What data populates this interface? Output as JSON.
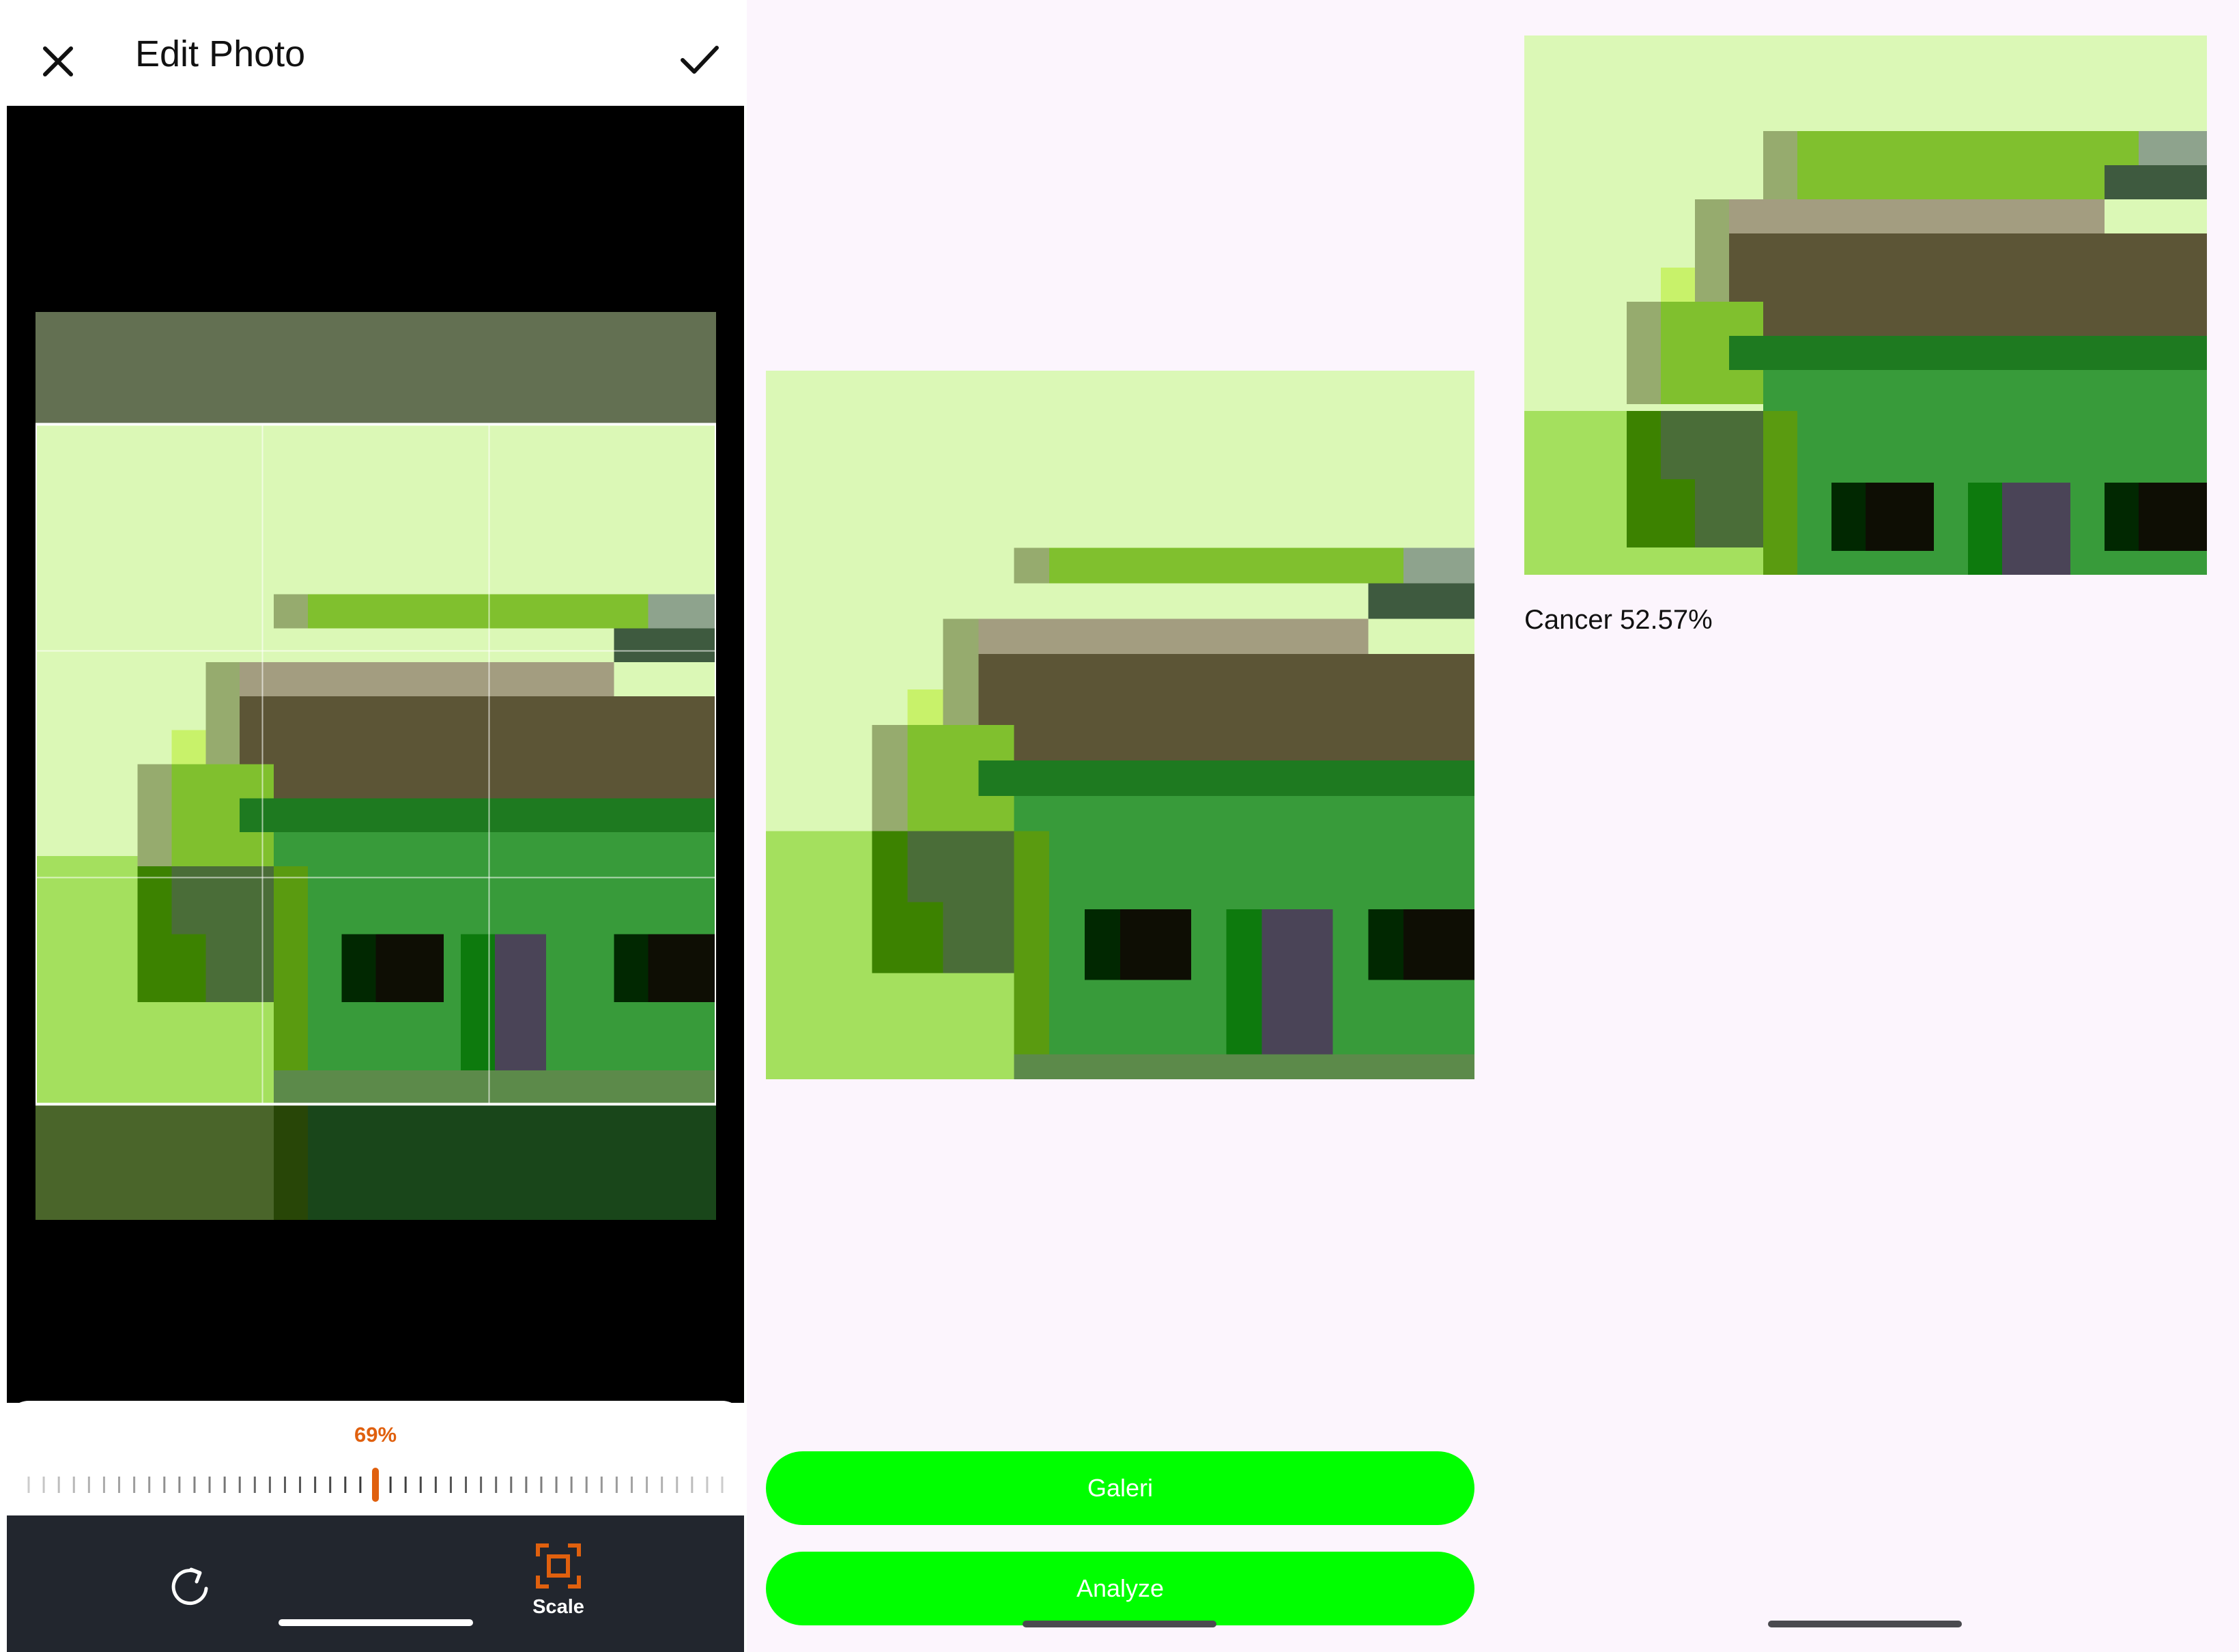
{
  "editor": {
    "title": "Edit Photo",
    "close_icon": "close-icon",
    "confirm_icon": "check-icon",
    "scale_percent": "69%",
    "scale_value": 0.69,
    "rotate_icon": "rotate-icon",
    "scale_label": "Scale",
    "scale_icon": "crop-scale-icon",
    "accent_color": "#e0600e",
    "toolbar_color": "#22262e"
  },
  "classifier": {
    "gallery_button": "Galeri",
    "analyze_button": "Analyze",
    "button_color": "#00ff00"
  },
  "result": {
    "label": "Cancer 52.57%"
  }
}
